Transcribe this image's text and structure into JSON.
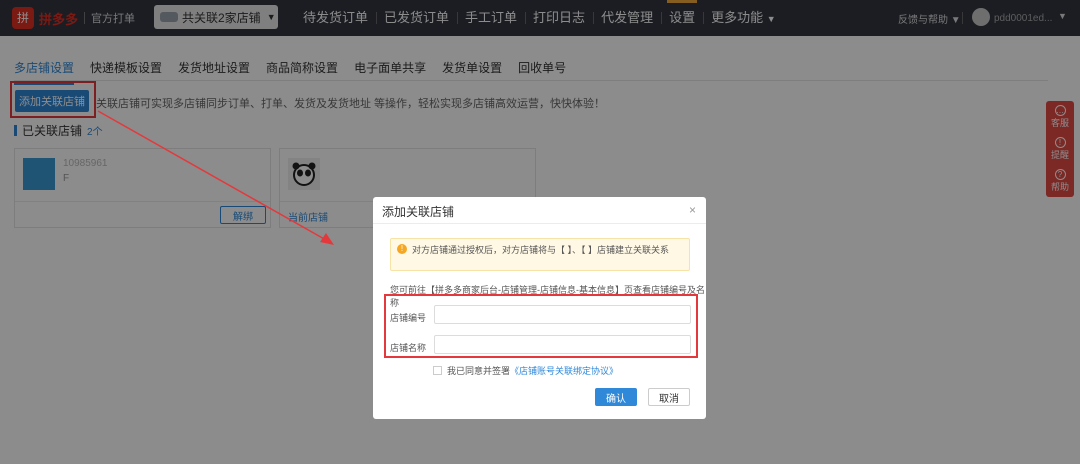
{
  "header": {
    "brand": "拼多多",
    "sub": "官方打单",
    "store_switch": "共关联2家店铺",
    "nav": [
      "待发货订单",
      "已发货订单",
      "手工订单",
      "打印日志",
      "代发管理",
      "设置",
      "更多功能"
    ],
    "active_nav": "设置",
    "more_caret": "▼",
    "help": "反馈与帮助",
    "user": "pdd0001ed..."
  },
  "tabs": [
    "多店铺设置",
    "快递模板设置",
    "发货地址设置",
    "商品简称设置",
    "电子面单共享",
    "发货单设置",
    "回收单号"
  ],
  "page": {
    "add_button": "添加关联店铺",
    "intro": "关联店铺可实现多店铺同步订单、打单、发货及发货地址 等操作，轻松实现多店铺高效运营，快快体验！",
    "linked_title": "已关联店铺",
    "linked_count": "2个"
  },
  "cards": [
    {
      "id": "10985961",
      "name": "F",
      "action": "解绑"
    },
    {
      "id": "",
      "name": "",
      "action": "当前店铺"
    }
  ],
  "side_tools": [
    "客服",
    "提醒",
    "帮助"
  ],
  "modal": {
    "title": "添加关联店铺",
    "close": "×",
    "notice": "对方店铺通过授权后，对方店铺将与【                    】、【                    】店铺建立关联关系",
    "hint": "您可前往【拼多多商家后台-店铺管理-店铺信息-基本信息】页查看店铺编号及名称",
    "shop_id_label": "店铺编号",
    "shop_name_label": "店铺名称",
    "shop_id_value": "",
    "shop_name_value": "",
    "agree_prefix": "我已同意并签署",
    "agree_link": "《店铺账号关联绑定协议》",
    "confirm": "确认",
    "cancel": "取消"
  },
  "colors": {
    "accent": "#2f88d8",
    "topbar": "#32363f",
    "highlight": "#e4393c",
    "brand": "#e02e24"
  }
}
